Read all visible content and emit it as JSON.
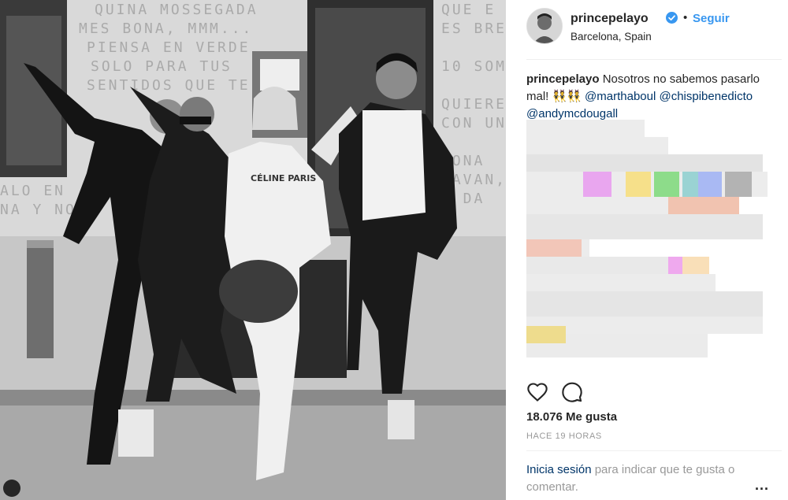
{
  "post": {
    "username": "princepelayo",
    "separator": "•",
    "follow_label": "Seguir",
    "location": "Barcelona, Spain",
    "caption_user": "princepelayo",
    "caption_text": "Nosotros no sabemos pasarlo mal! 👯👯",
    "mentions": [
      "@marthaboul",
      "@chispibenedicto",
      "@andymcdougall"
    ],
    "likes": "18.076 Me gusta",
    "time_ago": "HACE 19 HORAS",
    "login_link": "Inicia sesión",
    "login_text": "para indicar que te gusta o comentar.",
    "more_label": "..."
  },
  "photo": {
    "wall_text": [
      "QUINA MOSSEGADA",
      "MES BONA, MMM...",
      "PIENSA EN VERDE",
      "SOLO PARA TUS",
      "SENTIDOS QUE TE",
      "QUE E",
      "ES BRE",
      "10 SOM",
      "QUIERE",
      "CON UN",
      "DONA",
      "LAVAN, MES",
      "E DA",
      "ALO EN",
      "NA Y NO"
    ],
    "shirt_text": "CÉLINE PARIS"
  },
  "colors": {
    "accent": "#3897f0",
    "link": "#003569",
    "text": "#262626",
    "muted": "#999999"
  }
}
